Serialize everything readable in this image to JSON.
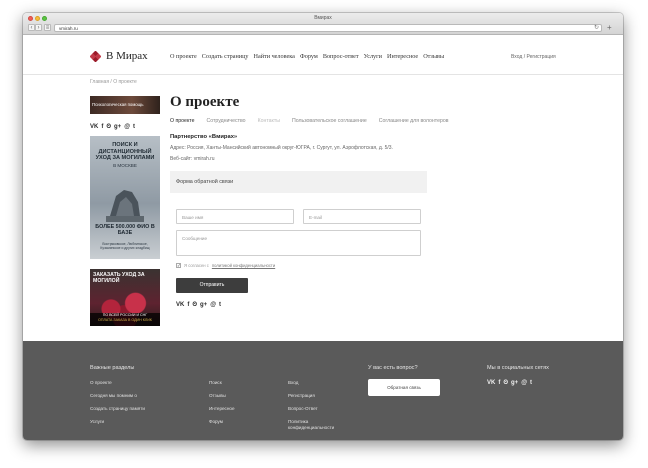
{
  "browser": {
    "window_title": "Вмирах",
    "url": "vmirah.ru",
    "new_tab_label": "+"
  },
  "header": {
    "logo_text": "В Мирах",
    "nav": [
      "О проекте",
      "Создать страницу",
      "Найти человека",
      "Форум",
      "Вопрос-ответ",
      "Услуги",
      "Интересное",
      "Отзывы"
    ],
    "login": "Вход / Регистрация"
  },
  "breadcrumb": "Главная / О проекте",
  "sidebar": {
    "ad_top": "Психологическая помощь",
    "ad_banner": {
      "headline": "ПОИСК И ДИСТАНЦИОННЫЙ УХОД ЗА МОГИЛАМИ",
      "city": "В МОСКВЕ",
      "count": "БОЛЕЕ 500.000 ФИО В БАЗЕ",
      "fine": "Востряковское, Люблинское, Кузьминское и других кладбищ"
    },
    "ad_flowers": {
      "headline": "ЗАКАЗАТЬ УХОД ЗА МОГИЛОЙ",
      "footer_line1": "ПО ВСЕЙ РОССИИ И СНГ",
      "footer_line2": "ОПЛАТА ЗАКАЗА В ОДИН КЛИК"
    }
  },
  "main": {
    "title": "О проекте",
    "tabs": [
      "О проекте",
      "Сотрудничество",
      "Контакты",
      "Пользовательское соглашение",
      "Соглашение для волонтеров"
    ],
    "partner": "Партнерство «Вмирах»",
    "address": "Адрес: Россия, Ханты-Мансийский автономный округ-ЮГРА, г. Сургут, ул. Аэрофлотская, д. 5/3.",
    "website": "Веб-сайт: vmirah.ru",
    "form": {
      "title": "Форма обратной связи",
      "name_placeholder": "Ваше имя",
      "email_placeholder": "E-mail",
      "message_placeholder": "Сообщение",
      "consent_text": "Я согласен с",
      "consent_link": "политикой конфиденциальности",
      "submit": "Отправить"
    }
  },
  "social": [
    "vk",
    "f",
    "ok",
    "g+",
    "mail",
    "twitter"
  ],
  "social_glyphs": [
    "VK",
    "f",
    "ʘ",
    "g+",
    "@",
    "t"
  ],
  "footer": {
    "sections_title": "Важные разделы",
    "col1": [
      "О проекте",
      "Сегодня мы помним о",
      "Создать страницу памяти",
      "Услуги"
    ],
    "col2": [
      "Поиск",
      "Отзывы",
      "Интересное",
      "Форум"
    ],
    "col3": [
      "Вход",
      "Регистрация",
      "Вопрос-Ответ",
      "Политика",
      "конфиденциальности"
    ],
    "question_title": "У вас есть вопрос?",
    "question_button": "Обратная связь",
    "social_title": "Мы в социальных сетях"
  }
}
